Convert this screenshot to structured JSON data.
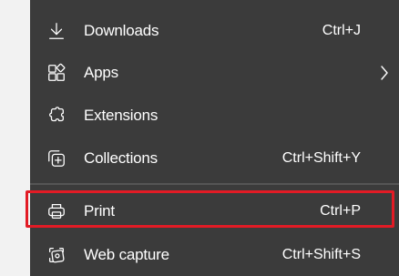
{
  "menu": {
    "items": [
      {
        "id": "downloads",
        "label": "Downloads",
        "shortcut": "Ctrl+J",
        "icon": "download-icon"
      },
      {
        "id": "apps",
        "label": "Apps",
        "shortcut": "",
        "icon": "apps-icon",
        "submenu": true
      },
      {
        "id": "extensions",
        "label": "Extensions",
        "shortcut": "",
        "icon": "extensions-icon"
      },
      {
        "id": "collections",
        "label": "Collections",
        "shortcut": "Ctrl+Shift+Y",
        "icon": "collections-icon"
      },
      {
        "id": "print",
        "label": "Print",
        "shortcut": "Ctrl+P",
        "icon": "print-icon",
        "highlighted": true
      },
      {
        "id": "web-capture",
        "label": "Web capture",
        "shortcut": "Ctrl+Shift+S",
        "icon": "web-capture-icon"
      }
    ]
  },
  "colors": {
    "menu_background": "#3b3b3b",
    "text": "#ffffff",
    "highlight_border": "#e21b25",
    "page_background": "#f2f2f2"
  }
}
